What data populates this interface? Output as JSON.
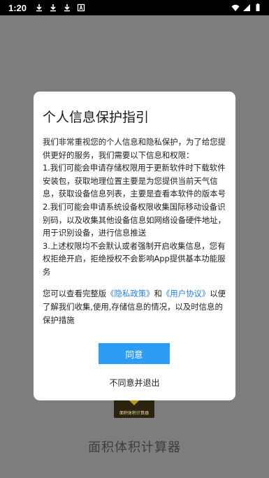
{
  "status_bar": {
    "time": "1:20",
    "icons": [
      "download-icon",
      "download-icon",
      "download-icon",
      "app-a-icon"
    ],
    "right_icons": [
      "wifi-icon",
      "signal-icon",
      "battery-icon"
    ]
  },
  "app": {
    "name": "面积体积计算器",
    "logo_text": "面积体积计算器"
  },
  "dialog": {
    "title": "个人信息保护指引",
    "body": "我们非常重视您的个人信息和隐私保护，为了给您提供更好的服务，我们需要以下信息和权限：\n1.我们可能会申请存储权限用于更新软件时下载软件安装包，获取地理位置主要是为您提供当前天气信息，获取设备信息列表，主要是查看本软件的版本号\n2.我们可能会申请系统设备权限收集国际移动设备识别码，以及收集其他设备信息如网络设备硬件地址，用于识别设备，进行信息推送\n3.上述权限均不会默认或者强制开启收集信息，您有权拒绝开启，拒绝授权不会影响App提供基本功能服务",
    "links_prefix": "您可以查看完整版",
    "privacy_link": "《隐私政策》",
    "links_and": "和",
    "user_link": "《用户协议》",
    "links_suffix": "以便了解我们收集,使用,存储信息的情况，以及时信息的保护措施",
    "agree_label": "同意",
    "disagree_label": "不同意并退出"
  }
}
